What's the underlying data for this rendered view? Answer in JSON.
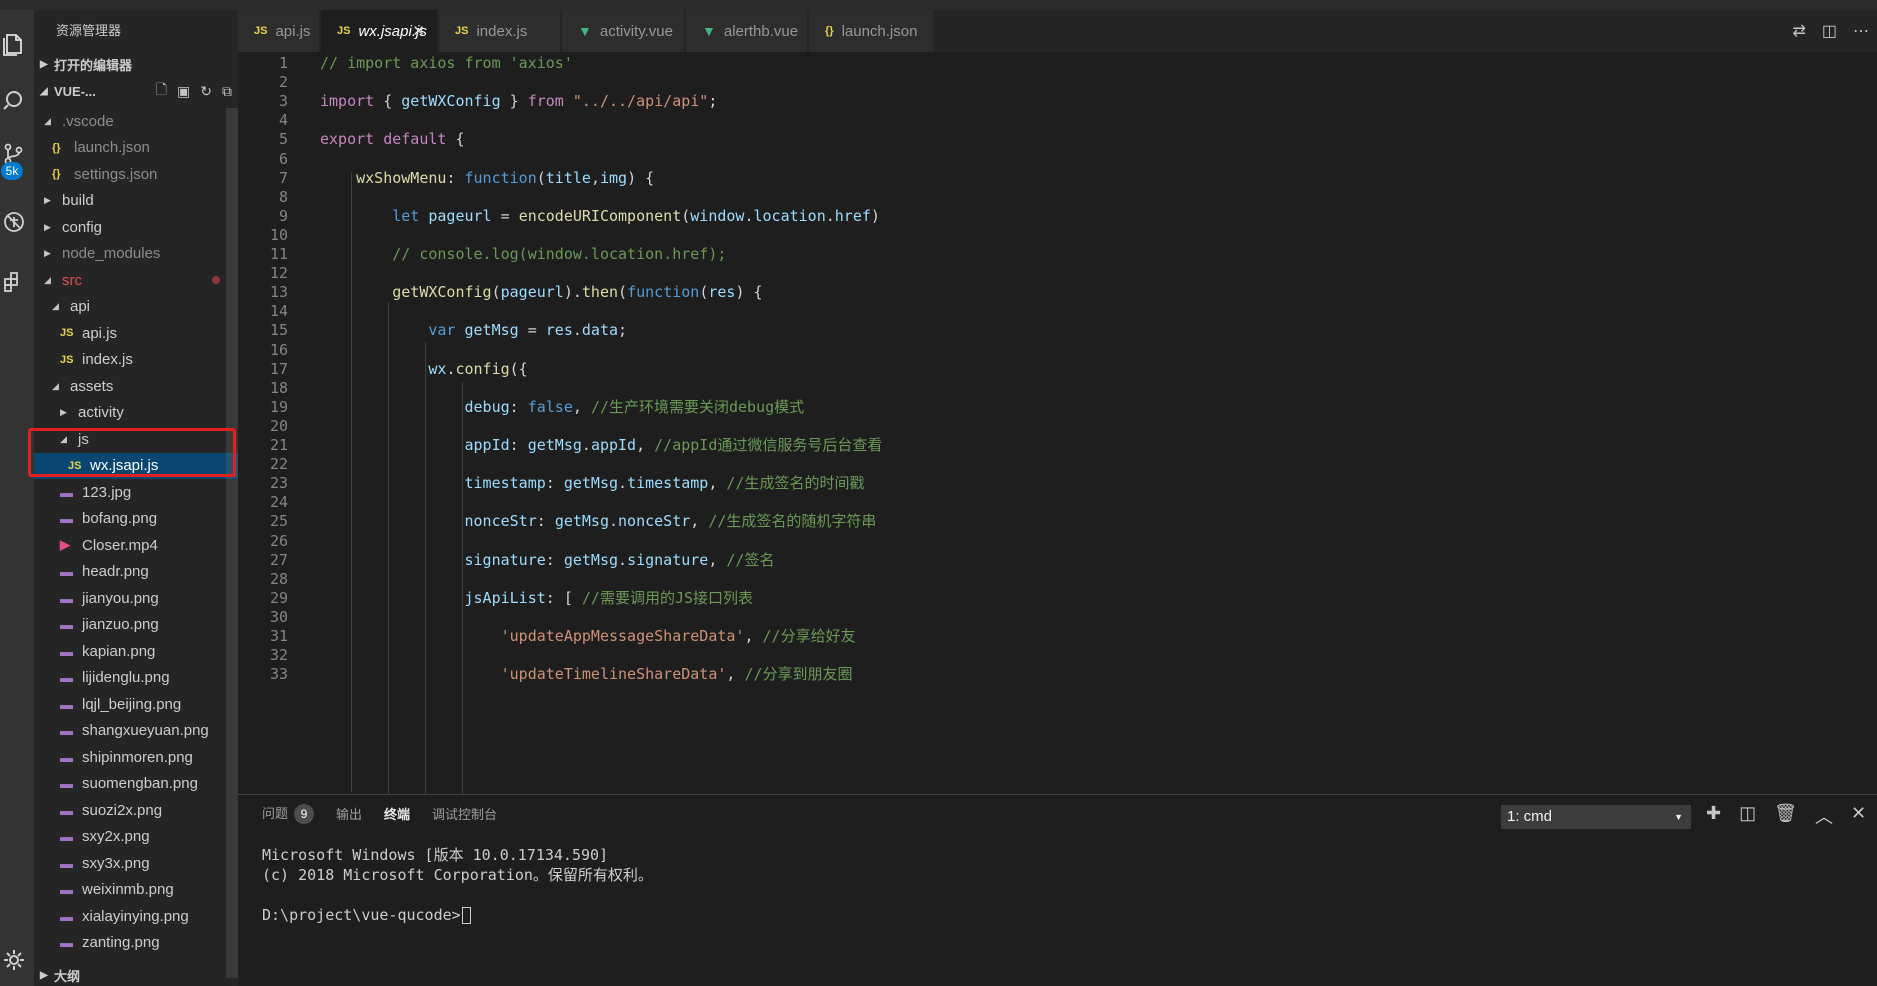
{
  "sidebar": {
    "title": "资源管理器",
    "open_editors_label": "打开的编辑器",
    "folder_label": "VUE-...",
    "outline_label": "大纲",
    "tree": [
      {
        "label": ".vscode",
        "icon": "chevron-down",
        "level": 1,
        "dim": true
      },
      {
        "label": "launch.json",
        "icon": "json",
        "level": 2,
        "dim": true
      },
      {
        "label": "settings.json",
        "icon": "json",
        "level": 2,
        "dim": true
      },
      {
        "label": "build",
        "icon": "chevron-right",
        "level": 1
      },
      {
        "label": "config",
        "icon": "chevron-right",
        "level": 1
      },
      {
        "label": "node_modules",
        "icon": "chevron-right",
        "level": 1,
        "dim": true
      },
      {
        "label": "src",
        "icon": "chevron-down",
        "level": 1,
        "red": true
      },
      {
        "label": "api",
        "icon": "chevron-down",
        "level": 2
      },
      {
        "label": "api.js",
        "icon": "js",
        "level": 3
      },
      {
        "label": "index.js",
        "icon": "js",
        "level": 3
      },
      {
        "label": "assets",
        "icon": "chevron-down",
        "level": 2
      },
      {
        "label": "activity",
        "icon": "chevron-right",
        "level": 3
      },
      {
        "label": "js",
        "icon": "chevron-down",
        "level": 3
      },
      {
        "label": "wx.jsapi.js",
        "icon": "js",
        "level": 4,
        "selected": true
      },
      {
        "label": "123.jpg",
        "icon": "image",
        "level": 3
      },
      {
        "label": "bofang.png",
        "icon": "image",
        "level": 3
      },
      {
        "label": "Closer.mp4",
        "icon": "video",
        "level": 3
      },
      {
        "label": "headr.png",
        "icon": "image",
        "level": 3
      },
      {
        "label": "jianyou.png",
        "icon": "image",
        "level": 3
      },
      {
        "label": "jianzuo.png",
        "icon": "image",
        "level": 3
      },
      {
        "label": "kapian.png",
        "icon": "image",
        "level": 3
      },
      {
        "label": "lijidenglu.png",
        "icon": "image",
        "level": 3
      },
      {
        "label": "lqjl_beijing.png",
        "icon": "image",
        "level": 3
      },
      {
        "label": "shangxueyuan.png",
        "icon": "image",
        "level": 3
      },
      {
        "label": "shipinmoren.png",
        "icon": "image",
        "level": 3
      },
      {
        "label": "suomengban.png",
        "icon": "image",
        "level": 3
      },
      {
        "label": "suozi2x.png",
        "icon": "image",
        "level": 3
      },
      {
        "label": "sxy2x.png",
        "icon": "image",
        "level": 3
      },
      {
        "label": "sxy3x.png",
        "icon": "image",
        "level": 3
      },
      {
        "label": "weixinmb.png",
        "icon": "image",
        "level": 3
      },
      {
        "label": "xialayinying.png",
        "icon": "image",
        "level": 3
      },
      {
        "label": "zanting.png",
        "icon": "image",
        "level": 3
      }
    ]
  },
  "activity_bar": {
    "scm_badge": "5k"
  },
  "tabs": [
    {
      "label": "api.js",
      "icon": "JS",
      "type": "js"
    },
    {
      "label": "wx.jsapi.js",
      "icon": "JS",
      "type": "js",
      "active": true
    },
    {
      "label": "index.js",
      "icon": "JS",
      "type": "js"
    },
    {
      "label": "activity.vue",
      "icon": "▼",
      "type": "vue"
    },
    {
      "label": "alerthb.vue",
      "icon": "▼",
      "type": "vue"
    },
    {
      "label": "launch.json",
      "icon": "{}",
      "type": "json"
    }
  ],
  "editor": {
    "lines": [
      [
        [
          "// import axios from 'axios'",
          "com"
        ]
      ],
      [],
      [
        [
          "import",
          "ctl"
        ],
        [
          " { ",
          "pun"
        ],
        [
          "getWXConfig",
          "var"
        ],
        [
          " } ",
          "pun"
        ],
        [
          "from",
          "ctl"
        ],
        [
          " ",
          "pun"
        ],
        [
          "\"../../api/api\"",
          "str"
        ],
        [
          ";",
          "pun"
        ]
      ],
      [],
      [
        [
          "export",
          "ctl"
        ],
        [
          " ",
          "pun"
        ],
        [
          "default",
          "ctl"
        ],
        [
          " {",
          "pun"
        ]
      ],
      [],
      [
        [
          "    ",
          "pun"
        ],
        [
          "wxShowMenu",
          "fn"
        ],
        [
          ": ",
          "pun"
        ],
        [
          "function",
          "kw"
        ],
        [
          "(",
          "pun"
        ],
        [
          "title",
          "var"
        ],
        [
          ",",
          "pun"
        ],
        [
          "img",
          "var"
        ],
        [
          ") {",
          "pun"
        ]
      ],
      [],
      [
        [
          "        ",
          "pun"
        ],
        [
          "let",
          "kw"
        ],
        [
          " ",
          "pun"
        ],
        [
          "pageurl",
          "var"
        ],
        [
          " = ",
          "pun"
        ],
        [
          "encodeURIComponent",
          "fn"
        ],
        [
          "(",
          "pun"
        ],
        [
          "window",
          "var"
        ],
        [
          ".",
          "pun"
        ],
        [
          "location",
          "var"
        ],
        [
          ".",
          "pun"
        ],
        [
          "href",
          "var"
        ],
        [
          ")",
          "pun"
        ]
      ],
      [],
      [
        [
          "        ",
          "pun"
        ],
        [
          "// console.log(window.location.href);",
          "com"
        ]
      ],
      [],
      [
        [
          "        ",
          "pun"
        ],
        [
          "getWXConfig",
          "fn"
        ],
        [
          "(",
          "pun"
        ],
        [
          "pageurl",
          "var"
        ],
        [
          ").",
          "pun"
        ],
        [
          "then",
          "fn"
        ],
        [
          "(",
          "pun"
        ],
        [
          "function",
          "kw"
        ],
        [
          "(",
          "pun"
        ],
        [
          "res",
          "var"
        ],
        [
          ") {",
          "pun"
        ]
      ],
      [],
      [
        [
          "            ",
          "pun"
        ],
        [
          "var",
          "kw"
        ],
        [
          " ",
          "pun"
        ],
        [
          "getMsg",
          "var"
        ],
        [
          " = ",
          "pun"
        ],
        [
          "res",
          "var"
        ],
        [
          ".",
          "pun"
        ],
        [
          "data",
          "var"
        ],
        [
          ";",
          "pun"
        ]
      ],
      [],
      [
        [
          "            ",
          "pun"
        ],
        [
          "wx",
          "var"
        ],
        [
          ".",
          "pun"
        ],
        [
          "config",
          "fn"
        ],
        [
          "({",
          "pun"
        ]
      ],
      [],
      [
        [
          "                ",
          "pun"
        ],
        [
          "debug",
          "var"
        ],
        [
          ": ",
          "pun"
        ],
        [
          "false",
          "kw"
        ],
        [
          ", ",
          "pun"
        ],
        [
          "//生产环境需要关闭debug模式",
          "com"
        ]
      ],
      [],
      [
        [
          "                ",
          "pun"
        ],
        [
          "appId",
          "var"
        ],
        [
          ": ",
          "pun"
        ],
        [
          "getMsg",
          "var"
        ],
        [
          ".",
          "pun"
        ],
        [
          "appId",
          "var"
        ],
        [
          ", ",
          "pun"
        ],
        [
          "//appId通过微信服务号后台查看",
          "com"
        ]
      ],
      [],
      [
        [
          "                ",
          "pun"
        ],
        [
          "timestamp",
          "var"
        ],
        [
          ": ",
          "pun"
        ],
        [
          "getMsg",
          "var"
        ],
        [
          ".",
          "pun"
        ],
        [
          "timestamp",
          "var"
        ],
        [
          ", ",
          "pun"
        ],
        [
          "//生成签名的时间戳",
          "com"
        ]
      ],
      [],
      [
        [
          "                ",
          "pun"
        ],
        [
          "nonceStr",
          "var"
        ],
        [
          ": ",
          "pun"
        ],
        [
          "getMsg",
          "var"
        ],
        [
          ".",
          "pun"
        ],
        [
          "nonceStr",
          "var"
        ],
        [
          ", ",
          "pun"
        ],
        [
          "//生成签名的随机字符串",
          "com"
        ]
      ],
      [],
      [
        [
          "                ",
          "pun"
        ],
        [
          "signature",
          "var"
        ],
        [
          ": ",
          "pun"
        ],
        [
          "getMsg",
          "var"
        ],
        [
          ".",
          "pun"
        ],
        [
          "signature",
          "var"
        ],
        [
          ", ",
          "pun"
        ],
        [
          "//签名",
          "com"
        ]
      ],
      [],
      [
        [
          "                ",
          "pun"
        ],
        [
          "jsApiList",
          "var"
        ],
        [
          ": [ ",
          "pun"
        ],
        [
          "//需要调用的JS接口列表",
          "com"
        ]
      ],
      [],
      [
        [
          "                    ",
          "pun"
        ],
        [
          "'updateAppMessageShareData'",
          "str"
        ],
        [
          ", ",
          "pun"
        ],
        [
          "//分享给好友",
          "com"
        ]
      ],
      [],
      [
        [
          "                    ",
          "pun"
        ],
        [
          "'updateTimelineShareData'",
          "str"
        ],
        [
          ", ",
          "pun"
        ],
        [
          "//分享到朋友圈",
          "com"
        ]
      ]
    ]
  },
  "panel": {
    "tabs": [
      {
        "label": "问题",
        "badge": "9"
      },
      {
        "label": "输出"
      },
      {
        "label": "终端",
        "active": true
      },
      {
        "label": "调试控制台"
      }
    ],
    "terminal_selector": "1: cmd",
    "terminal_lines": [
      "Microsoft Windows [版本 10.0.17134.590]",
      "(c) 2018 Microsoft Corporation。保留所有权利。",
      "",
      "D:\\project\\vue-qucode>"
    ]
  },
  "colors": {
    "accent": "#007acc",
    "selection": "#094771",
    "highlight_box": "#e02020"
  }
}
